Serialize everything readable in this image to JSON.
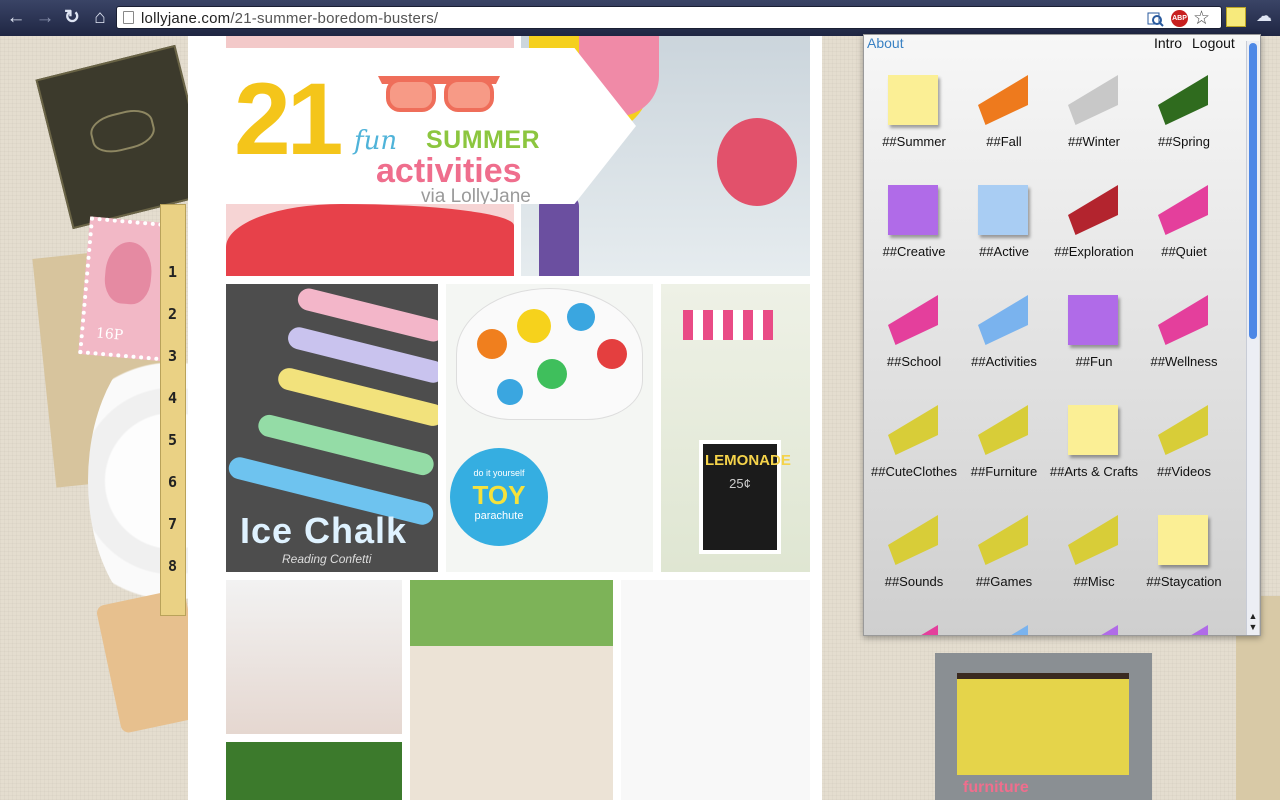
{
  "browser": {
    "url_domain": "lollyjane.com",
    "url_path": "/21-summer-boredom-busters/",
    "icons": [
      "back-arrow-icon",
      "forward-arrow-icon",
      "reload-icon",
      "home-icon",
      "page-icon",
      "lookup-icon",
      "adblock-icon",
      "star-icon",
      "sticky-note-icon",
      "cloud-icon"
    ],
    "abp_label": "ABP"
  },
  "header_graphic": {
    "number": "21",
    "word_fun": "fun",
    "word_summer": "SUMMER",
    "word_activities": "activities",
    "via": "via LollyJane"
  },
  "tiles": {
    "chalk_title": "Ice Chalk",
    "chalk_credit": "Reading Confetti",
    "toy_small": "do it yourself",
    "toy_big": "TOY",
    "toy_sub": "parachute",
    "lemonade_word": "LEMONADE",
    "lemonade_price": "25¢",
    "furniture_label": "furniture"
  },
  "ruler": {
    "numbers": [
      "1",
      "2",
      "3",
      "4",
      "5",
      "6",
      "7",
      "8"
    ]
  },
  "stamp": {
    "value": "16P"
  },
  "popup": {
    "about": "About",
    "intro": "Intro",
    "logout": "Logout",
    "scroll_up": "▲",
    "scroll_down": "▼",
    "categories": [
      {
        "label": "##Summer",
        "color": "#fbef95",
        "style": "plain"
      },
      {
        "label": "##Fall",
        "color": "#ee7a1d",
        "style": "fold"
      },
      {
        "label": "##Winter",
        "color": "#c8c8c8",
        "style": "fold"
      },
      {
        "label": "##Spring",
        "color": "#2f6b1e",
        "style": "fold"
      },
      {
        "label": "##Creative",
        "color": "#b06be8",
        "style": "plain"
      },
      {
        "label": "##Active",
        "color": "#a9cdf3",
        "style": "plain"
      },
      {
        "label": "##Exploration",
        "color": "#b3242e",
        "style": "fold"
      },
      {
        "label": "##Quiet",
        "color": "#e43f9c",
        "style": "fold"
      },
      {
        "label": "##School",
        "color": "#e43f9c",
        "style": "fold"
      },
      {
        "label": "##Activities",
        "color": "#7ab3ee",
        "style": "fold"
      },
      {
        "label": "##Fun",
        "color": "#b06be8",
        "style": "plain"
      },
      {
        "label": "##Wellness",
        "color": "#e43f9c",
        "style": "fold"
      },
      {
        "label": "##CuteClothes",
        "color": "#d8cd38",
        "style": "fold"
      },
      {
        "label": "##Furniture",
        "color": "#d8cd38",
        "style": "fold"
      },
      {
        "label": "##Arts & Crafts",
        "color": "#fbef95",
        "style": "plain"
      },
      {
        "label": "##Videos",
        "color": "#d8cd38",
        "style": "fold"
      },
      {
        "label": "##Sounds",
        "color": "#d8cd38",
        "style": "fold"
      },
      {
        "label": "##Games",
        "color": "#d8cd38",
        "style": "fold"
      },
      {
        "label": "##Misc",
        "color": "#d8cd38",
        "style": "fold"
      },
      {
        "label": "##Staycation",
        "color": "#fbef95",
        "style": "plain"
      },
      {
        "label": "",
        "color": "#e43f9c",
        "style": "fold"
      },
      {
        "label": "",
        "color": "#7ab3ee",
        "style": "fold"
      },
      {
        "label": "",
        "color": "#b06be8",
        "style": "fold"
      },
      {
        "label": "",
        "color": "#b06be8",
        "style": "fold"
      }
    ]
  }
}
